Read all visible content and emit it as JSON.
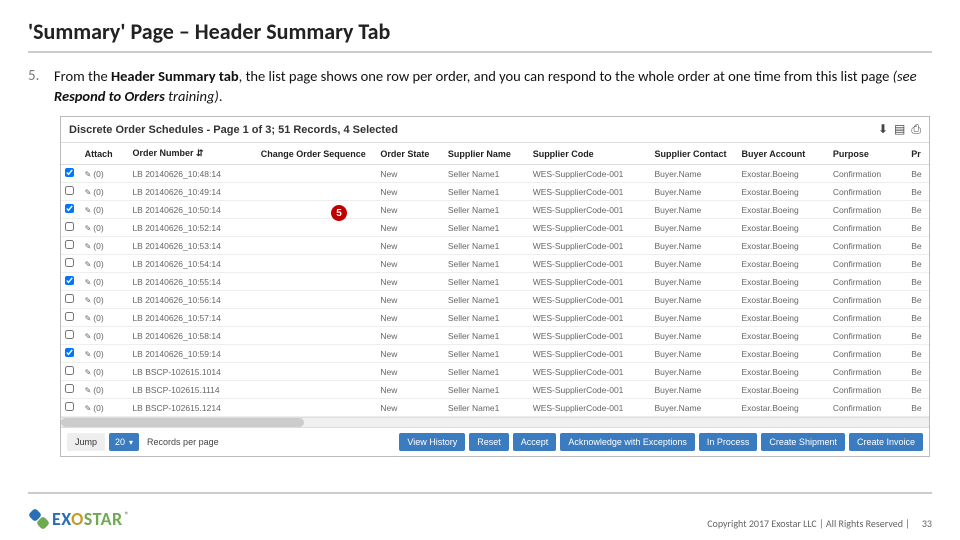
{
  "title": "'Summary' Page – Header Summary Tab",
  "step_number": "5.",
  "body_html": "From the <b>Header Summary tab</b>, the list page shows one row per order, and you can respond to the whole order at one time from this list page <i>(see <b>Respond to Orders</b> training)</i>.",
  "callout": "5",
  "screenshot": {
    "title": "Discrete Order Schedules - Page 1 of 3; 51 Records, 4 Selected",
    "export_icons": [
      "download-icon",
      "csv-icon",
      "print-icon"
    ],
    "columns": [
      "",
      "Attach",
      "Order Number ⇵",
      "Change Order Sequence",
      "Order State",
      "Supplier Name",
      "Supplier Code",
      "Supplier Contact",
      "Buyer Account",
      "Purpose",
      "Pr"
    ],
    "rows": [
      {
        "chk": true,
        "attach": "(0)",
        "order": "LB 20140626_10:48:14",
        "seq": "",
        "state": "New",
        "sname": "Seller Name1",
        "scode": "WES-SupplierCode-001",
        "scontact": "Buyer.Name",
        "bacct": "Exostar.Boeing",
        "purpose": "Confirmation",
        "pr": "Be"
      },
      {
        "chk": false,
        "attach": "(0)",
        "order": "LB 20140626_10:49:14",
        "seq": "",
        "state": "New",
        "sname": "Seller Name1",
        "scode": "WES-SupplierCode-001",
        "scontact": "Buyer.Name",
        "bacct": "Exostar.Boeing",
        "purpose": "Confirmation",
        "pr": "Be"
      },
      {
        "chk": true,
        "attach": "(0)",
        "order": "LB 20140626_10:50:14",
        "seq": "",
        "state": "New",
        "sname": "Seller Name1",
        "scode": "WES-SupplierCode-001",
        "scontact": "Buyer.Name",
        "bacct": "Exostar.Boeing",
        "purpose": "Confirmation",
        "pr": "Be"
      },
      {
        "chk": false,
        "attach": "(0)",
        "order": "LB 20140626_10:52:14",
        "seq": "",
        "state": "New",
        "sname": "Seller Name1",
        "scode": "WES-SupplierCode-001",
        "scontact": "Buyer.Name",
        "bacct": "Exostar.Boeing",
        "purpose": "Confirmation",
        "pr": "Be"
      },
      {
        "chk": false,
        "attach": "(0)",
        "order": "LB 20140626_10:53:14",
        "seq": "",
        "state": "New",
        "sname": "Seller Name1",
        "scode": "WES-SupplierCode-001",
        "scontact": "Buyer.Name",
        "bacct": "Exostar.Boeing",
        "purpose": "Confirmation",
        "pr": "Be"
      },
      {
        "chk": false,
        "attach": "(0)",
        "order": "LB 20140626_10:54:14",
        "seq": "",
        "state": "New",
        "sname": "Seller Name1",
        "scode": "WES-SupplierCode-001",
        "scontact": "Buyer.Name",
        "bacct": "Exostar.Boeing",
        "purpose": "Confirmation",
        "pr": "Be"
      },
      {
        "chk": true,
        "attach": "(0)",
        "order": "LB 20140626_10:55:14",
        "seq": "",
        "state": "New",
        "sname": "Seller Name1",
        "scode": "WES-SupplierCode-001",
        "scontact": "Buyer.Name",
        "bacct": "Exostar.Boeing",
        "purpose": "Confirmation",
        "pr": "Be"
      },
      {
        "chk": false,
        "attach": "(0)",
        "order": "LB 20140626_10:56:14",
        "seq": "",
        "state": "New",
        "sname": "Seller Name1",
        "scode": "WES-SupplierCode-001",
        "scontact": "Buyer.Name",
        "bacct": "Exostar.Boeing",
        "purpose": "Confirmation",
        "pr": "Be"
      },
      {
        "chk": false,
        "attach": "(0)",
        "order": "LB 20140626_10:57:14",
        "seq": "",
        "state": "New",
        "sname": "Seller Name1",
        "scode": "WES-SupplierCode-001",
        "scontact": "Buyer.Name",
        "bacct": "Exostar.Boeing",
        "purpose": "Confirmation",
        "pr": "Be"
      },
      {
        "chk": false,
        "attach": "(0)",
        "order": "LB 20140626_10:58:14",
        "seq": "",
        "state": "New",
        "sname": "Seller Name1",
        "scode": "WES-SupplierCode-001",
        "scontact": "Buyer.Name",
        "bacct": "Exostar.Boeing",
        "purpose": "Confirmation",
        "pr": "Be"
      },
      {
        "chk": true,
        "attach": "(0)",
        "order": "LB 20140626_10:59:14",
        "seq": "",
        "state": "New",
        "sname": "Seller Name1",
        "scode": "WES-SupplierCode-001",
        "scontact": "Buyer.Name",
        "bacct": "Exostar.Boeing",
        "purpose": "Confirmation",
        "pr": "Be"
      },
      {
        "chk": false,
        "attach": "(0)",
        "order": "LB BSCP-102615.1014",
        "seq": "",
        "state": "New",
        "sname": "Seller Name1",
        "scode": "WES-SupplierCode-001",
        "scontact": "Buyer.Name",
        "bacct": "Exostar.Boeing",
        "purpose": "Confirmation",
        "pr": "Be"
      },
      {
        "chk": false,
        "attach": "(0)",
        "order": "LB BSCP-102615.1114",
        "seq": "",
        "state": "New",
        "sname": "Seller Name1",
        "scode": "WES-SupplierCode-001",
        "scontact": "Buyer.Name",
        "bacct": "Exostar.Boeing",
        "purpose": "Confirmation",
        "pr": "Be"
      },
      {
        "chk": false,
        "attach": "(0)",
        "order": "LB BSCP-102615.1214",
        "seq": "",
        "state": "New",
        "sname": "Seller Name1",
        "scode": "WES-SupplierCode-001",
        "scontact": "Buyer.Name",
        "bacct": "Exostar.Boeing",
        "purpose": "Confirmation",
        "pr": "Be"
      }
    ],
    "toolbar": {
      "jump": "Jump",
      "page_size": "20",
      "rpp_label": "Records per page",
      "buttons": [
        "View History",
        "Reset",
        "Accept",
        "Acknowledge with Exceptions",
        "In Process",
        "Create Shipment",
        "Create Invoice"
      ]
    }
  },
  "footer": {
    "logo_text_parts": [
      "EX",
      "O",
      "STAR"
    ],
    "logo_reg": "®",
    "copyright": "Copyright 2017 Exostar LLC | All Rights Reserved |",
    "page_number": "33"
  }
}
